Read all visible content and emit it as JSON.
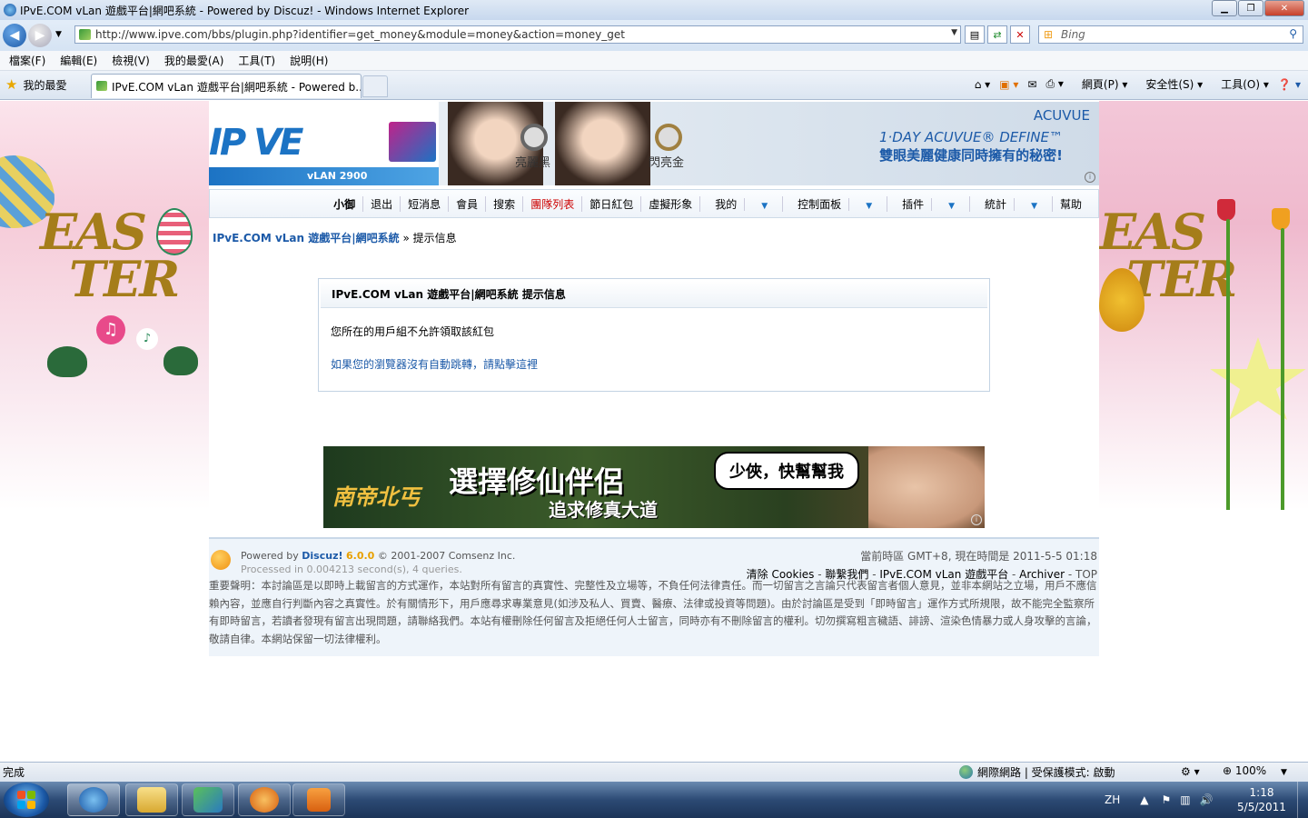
{
  "window": {
    "title": "IPvE.COM vLan 遊戲平台|網吧系統 - Powered by Discuz! - Windows Internet Explorer"
  },
  "address": {
    "url": "http://www.ipve.com/bbs/plugin.php?identifier=get_money&module=money&action=money_get",
    "search_placeholder": "Bing"
  },
  "menu": [
    "檔案(F)",
    "編輯(E)",
    "檢視(V)",
    "我的最愛(A)",
    "工具(T)",
    "說明(H)"
  ],
  "favorites_label": "我的最愛",
  "tab": {
    "title": "IPvE.COM vLan 遊戲平台|網吧系統 - Powered b..."
  },
  "commands": {
    "page": "網頁(P)",
    "safety": "安全性(S)",
    "tools": "工具(O)"
  },
  "banner": {
    "logo_text": "IP VE",
    "logo_sub": "vLAN 2900",
    "label_black": "亮麗黑",
    "label_shine": "閃亮金",
    "brand": "ACUVUE",
    "product": "1·DAY ACUVUE® DEFINE™",
    "tagline": "雙眼美麗健康同時擁有的秘密!"
  },
  "deco": {
    "left_line1": "EAS",
    "left_line2": "TER",
    "right_line1": "EAS",
    "right_line2": "TER"
  },
  "nav": {
    "items": [
      {
        "label": "小御",
        "style": "bold"
      },
      {
        "label": "退出"
      },
      {
        "label": "短消息"
      },
      {
        "label": "會員"
      },
      {
        "label": "搜索"
      },
      {
        "label": "團隊列表",
        "style": "red"
      },
      {
        "label": "節日紅包"
      },
      {
        "label": "虛擬形象"
      },
      {
        "label": "我的",
        "dropdown": true
      },
      {
        "label": "控制面板",
        "dropdown": true
      },
      {
        "label": "插件",
        "dropdown": true
      },
      {
        "label": "統計",
        "dropdown": true
      },
      {
        "label": "幫助"
      }
    ]
  },
  "breadcrumb": {
    "home": "IPvE.COM vLan 遊戲平台|網吧系統",
    "sep": "»",
    "current": "提示信息"
  },
  "message": {
    "header": "IPvE.COM vLan 遊戲平台|網吧系統 提示信息",
    "text": "您所在的用戶組不允許領取該紅包",
    "redirect": "如果您的瀏覽器沒有自動跳轉，請點擊這裡"
  },
  "ad_bottom": {
    "logo": "南帝北丐",
    "headline": "選擇修仙伴侶",
    "sub": "追求修真大道",
    "bubble": "少俠，快幫幫我"
  },
  "footer": {
    "powered_prefix": "Powered by",
    "powered_name": "Discuz!",
    "version": "6.0.0",
    "copyright": "© 2001-2007 Comsenz Inc.",
    "processed": "Processed in 0.004213 second(s), 4 queries.",
    "time": "當前時區 GMT+8, 現在時間是 2011-5-5 01:18",
    "links": [
      "清除 Cookies",
      "聯繫我們",
      "IPvE.COM vLan 遊戲平台",
      "Archiver",
      "TOP"
    ],
    "disclaimer": "重要聲明：本討論區是以即時上載留言的方式運作，本站對所有留言的真實性、完整性及立場等，不負任何法律責任。而一切留言之言論只代表留言者個人意見，並非本網站之立場，用戶不應信賴內容，並應自行判斷內容之真實性。於有關情形下，用戶應尋求專業意見(如涉及私人、買賣、醫療、法律或投資等問題)。由於討論區是受到「即時留言」運作方式所規限，故不能完全監察所有即時留言，若讀者發現有留言出現問題，請聯絡我們。本站有權刪除任何留言及拒絕任何人士留言，同時亦有不刪除留言的權利。切勿撰寫粗言穢語、誹謗、渲染色情暴力或人身攻擊的言論，敬請自律。本網站保留一切法律權利。"
  },
  "status": {
    "text": "完成",
    "zone": "網際網路 | 受保護模式: 啟動",
    "zoom": "100%"
  },
  "taskbar": {
    "lang": "ZH",
    "time": "1:18",
    "date": "5/5/2011"
  }
}
